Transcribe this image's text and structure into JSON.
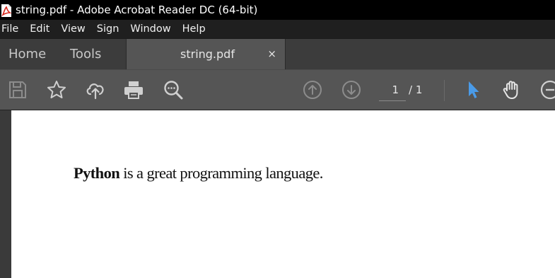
{
  "window": {
    "title": "string.pdf - Adobe Acrobat Reader DC (64-bit)"
  },
  "menu": [
    "File",
    "Edit",
    "View",
    "Sign",
    "Window",
    "Help"
  ],
  "tabs": {
    "home": "Home",
    "tools": "Tools",
    "document": "string.pdf",
    "close": "×"
  },
  "toolbar": {
    "icons": [
      "save-icon",
      "bookmark-star-icon",
      "cloud-upload-icon",
      "print-icon",
      "search-comment-icon",
      "page-up-icon",
      "page-down-icon",
      "select-cursor-icon",
      "hand-tool-icon",
      "zoom-out-icon"
    ],
    "page_current": "1",
    "page_total": "/ 1"
  },
  "document": {
    "bold_word": "Python",
    "rest_text": " is a great programming language."
  },
  "colors": {
    "titlebar": "#000000",
    "menubar": "#1f1f1f",
    "toolbar": "#555555",
    "accent_cursor": "#4a9be8",
    "icon_gray": "#cfcfcf",
    "icon_disabled": "#8c8c8c"
  }
}
